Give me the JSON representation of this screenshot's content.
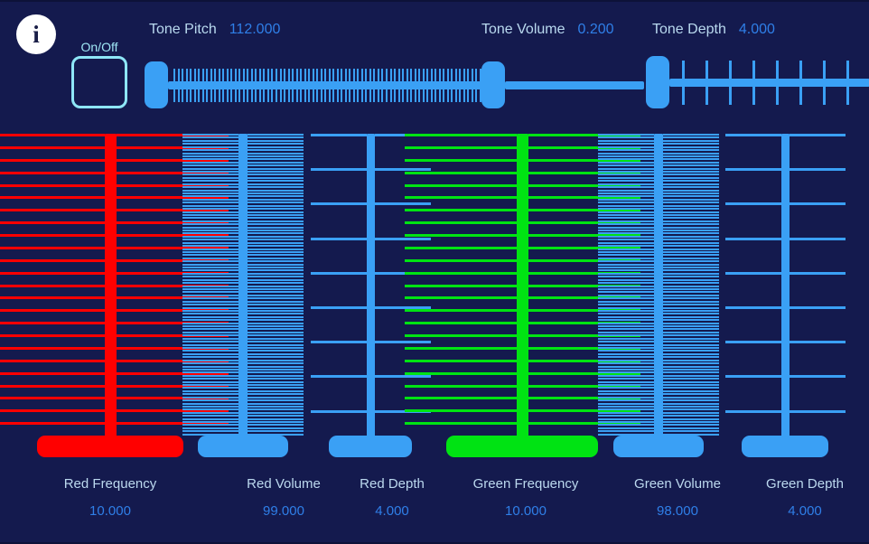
{
  "theme": {
    "background": "#141a4e",
    "accent_blue": "#3aa0f5",
    "red": "#ff0000",
    "green": "#00e313",
    "label_color": "#bcd9ef",
    "value_color": "#2f7fe8",
    "checkbox_border": "#8ee6f7"
  },
  "header": {
    "info_icon": "info-icon",
    "info_glyph": "i",
    "onoff": {
      "label": "On/Off",
      "checked": false
    },
    "sliders": [
      {
        "name": "Tone Pitch",
        "value": "112.000",
        "tick_style": "dense",
        "tick_count": 78,
        "handle_pct": 0
      },
      {
        "name": "Tone Volume",
        "value": "0.200",
        "tick_style": "none",
        "tick_count": 0,
        "handle_pct": 0
      },
      {
        "name": "Tone Depth",
        "value": "4.000",
        "tick_style": "sparse",
        "tick_count": 9,
        "handle_pct": 0
      }
    ]
  },
  "channels": [
    {
      "label": "Red Frequency",
      "value": "10.000",
      "color": "#ff0000",
      "tick_style": "medium",
      "tick_count": 24,
      "handle_pct": 0
    },
    {
      "label": "Red Volume",
      "value": "99.000",
      "color": "#3aa0f5",
      "tick_style": "dense",
      "tick_count": 99,
      "handle_pct": 0
    },
    {
      "label": "Red Depth",
      "value": "4.000",
      "color": "#3aa0f5",
      "tick_style": "sparse",
      "tick_count": 9,
      "handle_pct": 0
    },
    {
      "label": "Green Frequency",
      "value": "10.000",
      "color": "#00e313",
      "tick_style": "medium",
      "tick_count": 24,
      "handle_pct": 0
    },
    {
      "label": "Green Volume",
      "value": "98.000",
      "color": "#3aa0f5",
      "tick_style": "dense",
      "tick_count": 98,
      "handle_pct": 0
    },
    {
      "label": "Green Depth",
      "value": "4.000",
      "color": "#3aa0f5",
      "tick_style": "sparse",
      "tick_count": 9,
      "handle_pct": 0
    }
  ]
}
